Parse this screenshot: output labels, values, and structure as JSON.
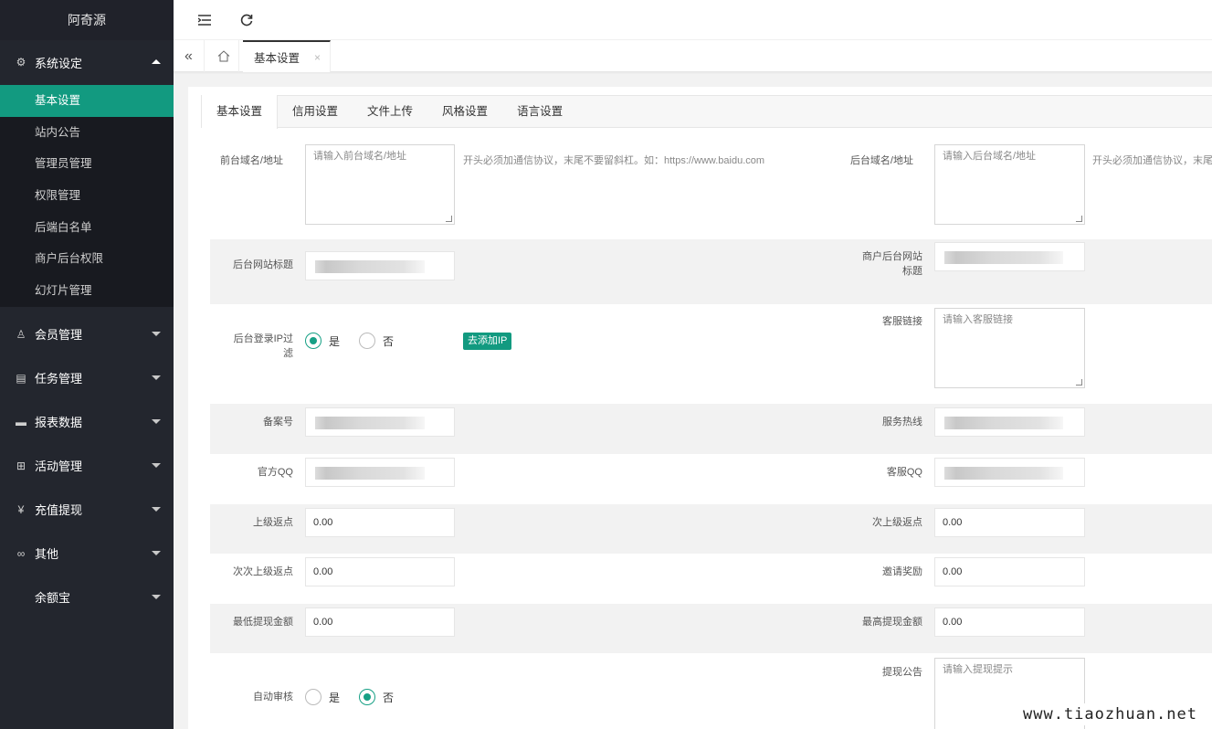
{
  "app": {
    "title": "阿奇源"
  },
  "sidebar": {
    "groups": [
      {
        "label": "系统设定",
        "icon": "gear-icon",
        "expanded": true
      },
      {
        "label": "会员管理",
        "icon": "user-icon"
      },
      {
        "label": "任务管理",
        "icon": "document-icon"
      },
      {
        "label": "报表数据",
        "icon": "chart-icon"
      },
      {
        "label": "活动管理",
        "icon": "book-icon"
      },
      {
        "label": "充值提现",
        "icon": "yen-icon"
      },
      {
        "label": "其他",
        "icon": "link-icon"
      },
      {
        "label": "余额宝",
        "icon": ""
      }
    ],
    "system_items": [
      "基本设置",
      "站内公告",
      "管理员管理",
      "权限管理",
      "后端白名单",
      "商户后台权限",
      "幻灯片管理"
    ]
  },
  "header": {
    "menu_icon": "menu-fold-icon",
    "refresh_icon": "refresh-icon"
  },
  "page_tabs": {
    "active": "基本设置",
    "close": "×"
  },
  "content_tabs": [
    "基本设置",
    "信用设置",
    "文件上传",
    "风格设置",
    "语言设置"
  ],
  "form": {
    "frontend_domain_label": "前台域名/地址",
    "frontend_domain_placeholder": "请输入前台域名/地址",
    "frontend_domain_hint": "开头必须加通信协议，末尾不要留斜杠。如：https://www.baidu.com",
    "backend_domain_label": "后台域名/地址",
    "backend_domain_placeholder": "请输入后台域名/地址",
    "backend_domain_hint": "开头必须加通信协议，末尾不",
    "site_title_label": "后台网站标题",
    "merchant_title_label_1": "商户后台网站",
    "merchant_title_label_2": "标题",
    "ip_filter_label_1": "后台登录IP过",
    "ip_filter_label_2": "滤",
    "yes": "是",
    "no": "否",
    "add_ip_button": "去添加IP",
    "service_link_label": "客服链接",
    "service_link_placeholder": "请输入客服链接",
    "icp_label": "备案号",
    "hotline_label": "服务热线",
    "official_qq_label": "官方QQ",
    "service_qq_label": "客服QQ",
    "upper_rebate_label": "上级返点",
    "upper_rebate_value": "0.00",
    "second_rebate_label": "次上级返点",
    "second_rebate_value": "0.00",
    "third_rebate_label": "次次上级返点",
    "third_rebate_value": "0.00",
    "invite_reward_label": "邀请奖励",
    "invite_reward_value": "0.00",
    "min_withdraw_label": "最低提现金额",
    "min_withdraw_value": "0.00",
    "max_withdraw_label": "最高提现金额",
    "max_withdraw_value": "0.00",
    "auto_review_label": "自动审核",
    "withdraw_notice_label": "提现公告",
    "withdraw_notice_placeholder": "请输入提现提示"
  },
  "watermark": "www.tiaozhuan.net",
  "colors": {
    "sidebar_bg": "#23262e",
    "accent": "#129a80"
  }
}
